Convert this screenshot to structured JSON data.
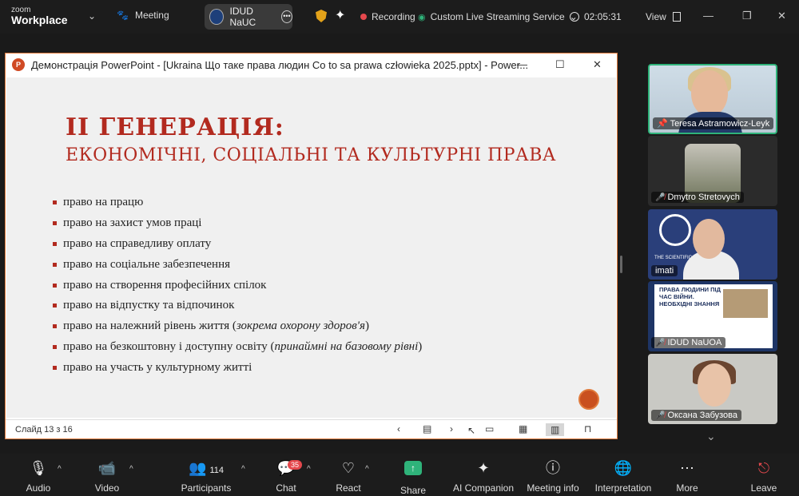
{
  "app": {
    "brand_top": "zoom",
    "brand_bottom": "Workplace"
  },
  "topbar": {
    "meeting_label": "Meeting",
    "host_tab": "IDUD NaUC",
    "recording_label": "Recording",
    "streaming_label": "Custom Live Streaming Service",
    "timer": "02:05:31",
    "view_label": "View"
  },
  "ppt": {
    "window_title": "Демонстрація PowerPoint - [Ukraina Що таке права людин Co to sa prawa człowieka 2025.pptx] - Power...",
    "slide_counter": "Слайд 13 з 16",
    "heading1": "II ГЕНЕРАЦІЯ:",
    "heading2": "ЕКОНОМІЧНІ, СОЦІАЛЬНІ ТА КУЛЬТУРНІ ПРАВА",
    "bullets": [
      {
        "text": "право на працю",
        "italic": "",
        "tail": ""
      },
      {
        "text": "право на захист умов праці",
        "italic": "",
        "tail": ""
      },
      {
        "text": "право на справедливу  оплату",
        "italic": "",
        "tail": ""
      },
      {
        "text": "право на соціальне забезпечення",
        "italic": "",
        "tail": ""
      },
      {
        "text": "право на створення професійних спілок",
        "italic": "",
        "tail": ""
      },
      {
        "text": "право на відпустку та відпочинок",
        "italic": "",
        "tail": ""
      },
      {
        "text": "право на належний  рівень життя (",
        "italic": "зокрема охорону здоров'я",
        "tail": ")"
      },
      {
        "text": "право на безкоштовну і доступну освіту (",
        "italic": "принаймні на базовому рівні",
        "tail": ")"
      },
      {
        "text": "право на участь у культурному житті",
        "italic": "",
        "tail": ""
      }
    ]
  },
  "participants_panel": {
    "tiles": [
      {
        "name": "Teresa Astramowicz-Leyk",
        "muted": false
      },
      {
        "name": "Dmytro Stretovych",
        "muted": true
      },
      {
        "name": "imati",
        "muted": false
      },
      {
        "name": "IDUD NaUOA",
        "muted": true
      },
      {
        "name": "Оксана Забузова",
        "muted": true
      }
    ],
    "tile3_logo_text": "THE SCIENTIFIC OF HISTORY O",
    "tile4_poster_title": "ПРАВА ЛЮДИНИ ПІД ЧАС ВІЙНИ. НЕОБХІДНІ ЗНАННЯ"
  },
  "bottombar": {
    "audio": "Audio",
    "video": "Video",
    "participants": "Participants",
    "participants_count": "114",
    "chat": "Chat",
    "chat_badge": "35",
    "react": "React",
    "share": "Share",
    "ai_companion": "AI Companion",
    "meeting_info": "Meeting info",
    "interpretation": "Interpretation",
    "more": "More",
    "leave": "Leave"
  },
  "colors": {
    "accent_red": "#b22a1f",
    "recording_dot": "#e5484d",
    "share_green": "#2fb37a"
  }
}
